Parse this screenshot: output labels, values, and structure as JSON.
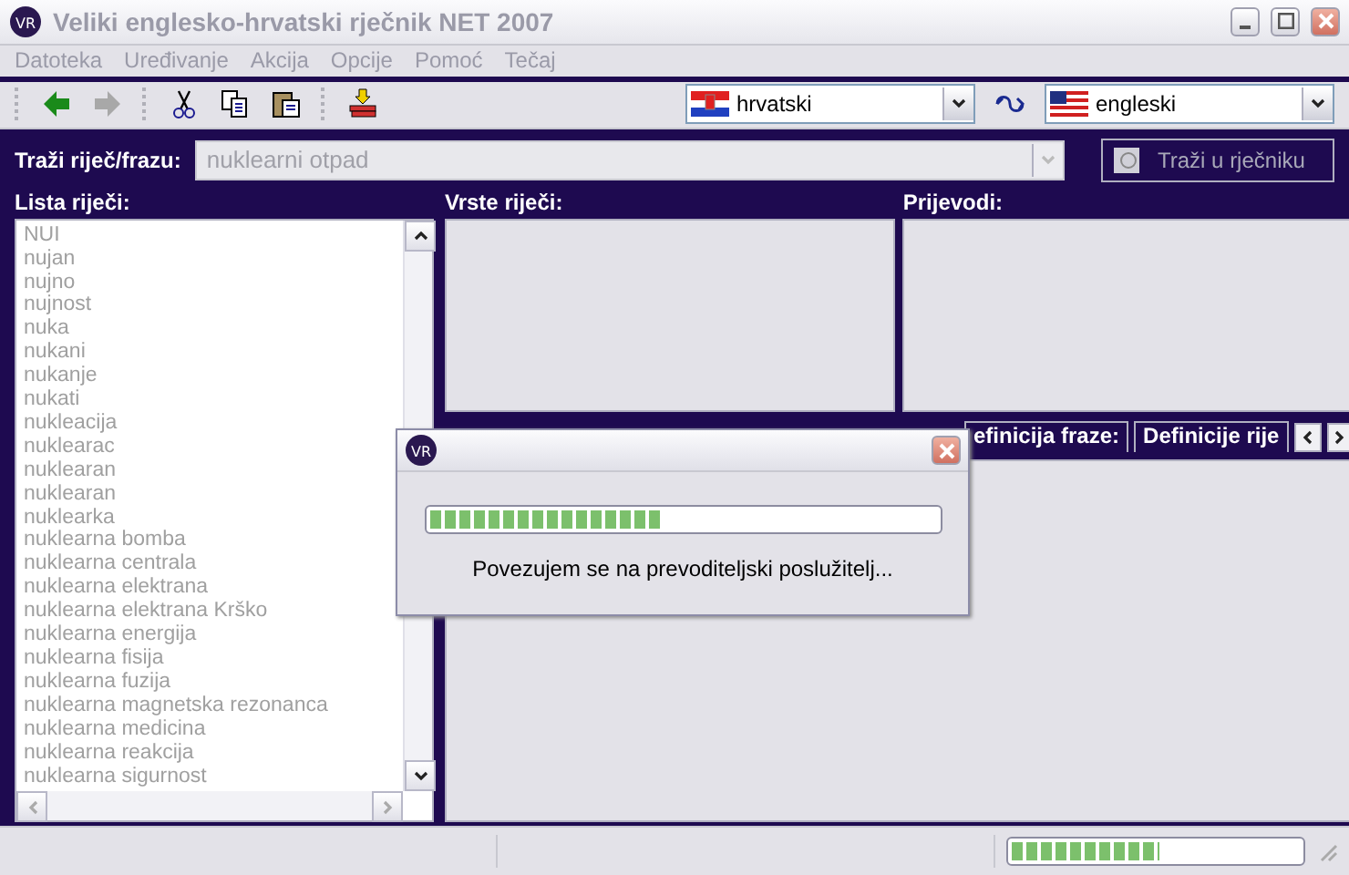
{
  "window": {
    "logo": "VR",
    "title": "Veliki englesko-hrvatski rječnik NET 2007"
  },
  "menu": [
    "Datoteka",
    "Uređivanje",
    "Akcija",
    "Opcije",
    "Pomoć",
    "Tečaj"
  ],
  "toolbar": {
    "source_language": "hrvatski",
    "target_language": "engleski"
  },
  "search": {
    "label": "Traži riječ/frazu:",
    "value": "nuklearni otpad",
    "button": "Traži u rječniku"
  },
  "word_list": {
    "title": "Lista riječi:",
    "items": [
      "NUI",
      "nujan",
      "nujno",
      "nujnost",
      "nuka",
      "nukani",
      "nukanje",
      "nukati",
      "nukleacija",
      "nuklearac",
      "nuklearan",
      "nuklearan",
      "nuklearka",
      "nuklearna bomba",
      "nuklearna centrala",
      "nuklearna elektrana",
      "nuklearna elektrana Krško",
      "nuklearna energija",
      "nuklearna fisija",
      "nuklearna fuzija",
      "nuklearna magnetska rezonanca",
      "nuklearna medicina",
      "nuklearna reakcija",
      "nuklearna sigurnost"
    ]
  },
  "word_types": {
    "title": "Vrste riječi:"
  },
  "translations": {
    "title": "Prijevodi:"
  },
  "tabs": [
    {
      "label": "efinicija fraze:"
    },
    {
      "label": "Definicije rije"
    }
  ],
  "dialog": {
    "logo": "VR",
    "message": "Povezujem se na prevoditeljski poslužitelj...",
    "level": 0.46
  },
  "status_bar": {
    "level": 0.51
  }
}
